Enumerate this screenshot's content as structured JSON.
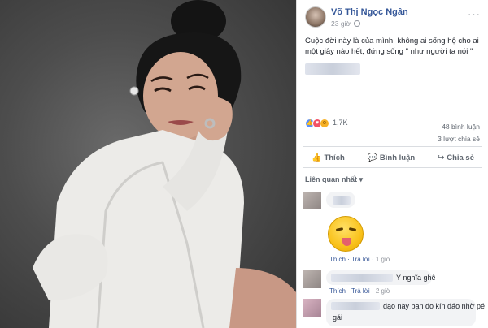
{
  "post": {
    "author": "Võ Thị Ngọc Ngân",
    "time": "23 giờ",
    "more_label": "···",
    "text": "Cuộc đời này là của mình, không ai sống hộ cho ai một giây nào hết, đứng sống \" như người ta nói \"",
    "reaction_count": "1,7K",
    "comment_count": "48 bình luận",
    "share_count": "3 lượt chia sẻ"
  },
  "actions": {
    "like_label": "Thích",
    "comment_label": "Bình luận",
    "share_label": "Chia sẻ"
  },
  "comments_sort": "Liên quan nhất ▾",
  "comments": [
    {
      "text": "",
      "meta_like": "Thích",
      "meta_reply": "Trả lời",
      "meta_time": "1 giờ"
    },
    {
      "text": "Ý nghĩa ghê",
      "meta_like": "Thích",
      "meta_reply": "Trả lời",
      "meta_time": "2 giờ"
    },
    {
      "text_line1": "dạo này bạn do kín đáo nhờ pé",
      "text_line2": "gái"
    }
  ],
  "icons": {
    "globe": "globe-icon",
    "like": "thumbs-up-icon",
    "comment": "speech-bubble-icon",
    "share": "share-arrow-icon"
  },
  "colors": {
    "author_link": "#365899",
    "like_reaction": "#5890ff",
    "love_reaction": "#f25268",
    "wow_reaction": "#f7b125"
  }
}
